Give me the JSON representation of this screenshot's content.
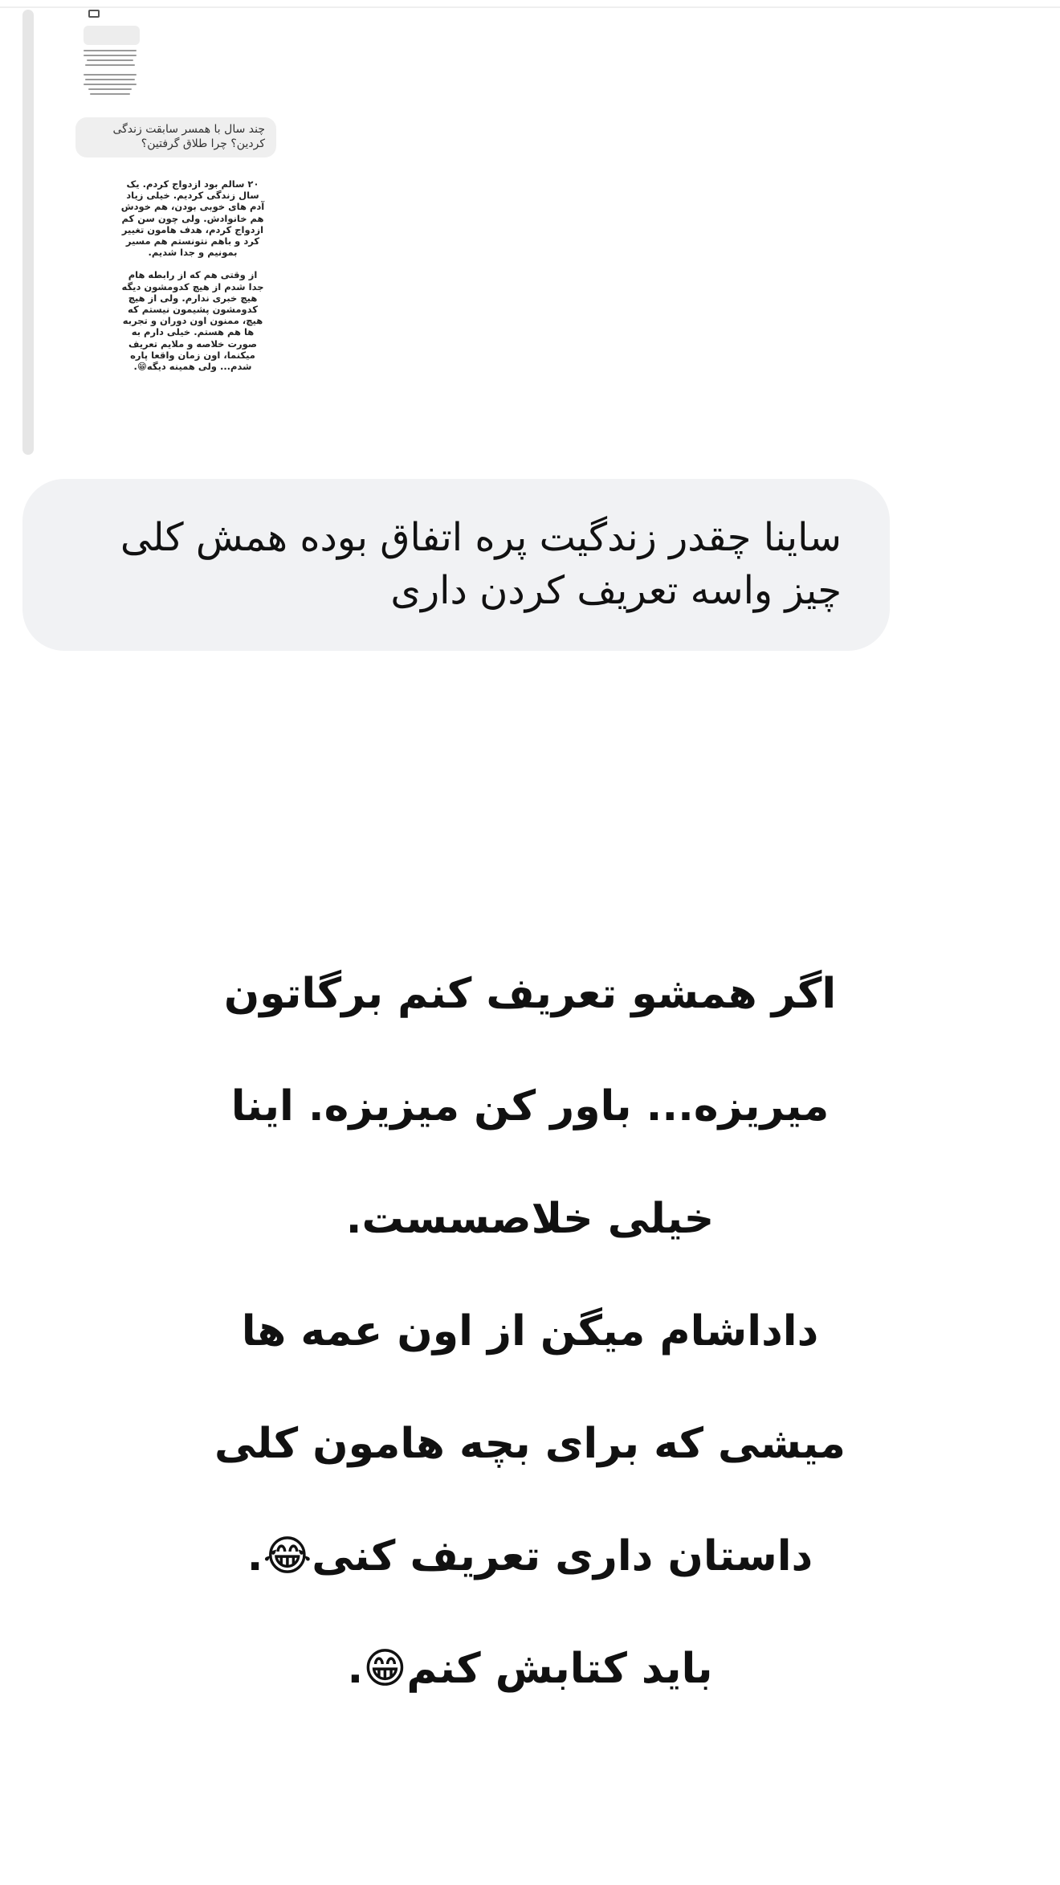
{
  "quoted_story": {
    "question": "چند سال با همسر سابقت زندگی کردین؟ چرا طلاق گرفتین؟",
    "answer_paragraphs": [
      "۲۰ سالم بود ازدواج کردم. یک سال زندگی کردیم. خیلی زیاد آدم های خوبی بودن، هم خودش هم خانوادش. ولی چون سن کم ازدواج کردم، هدف هامون تغییر کرد و باهم نتونستم هم مسیر بمونیم و جدا شدیم.",
      "از وقتی هم که از رابطه هام جدا شدم از هیچ کدومشون دیگه هیچ خبری ندارم. ولی از هیچ کدومشون پشیمون نیستم که هیچ، ممنون اون دوران و تجربه ها هم هستم. خیلی دارم به صورت خلاصه و ملایم تعریف میکنما، اون زمان واقعا پاره شدم... ولی همینه دیگه😁."
    ]
  },
  "reply_message": {
    "text": "ساینا چقدر زندگیت پره اتفاق بوده همش کلی چیز واسه تعریف کردن داری"
  },
  "story_text": {
    "lines": [
      "اگر همشو تعریف کنم برگاتون",
      "میریزه... باور کن میزیزه. اینا",
      "خیلی خلاصسست.",
      "داداشام میگن از اون عمه ها",
      "میشی که برای بچه هامون کلی",
      "داستان داری تعریف کنی😂.",
      "باید کتابش کنم😁."
    ]
  },
  "colors": {
    "background": "#ffffff",
    "reply_bubble": "#f1f2f4",
    "quote_bar": "#e6e6e6",
    "text": "#111111"
  }
}
